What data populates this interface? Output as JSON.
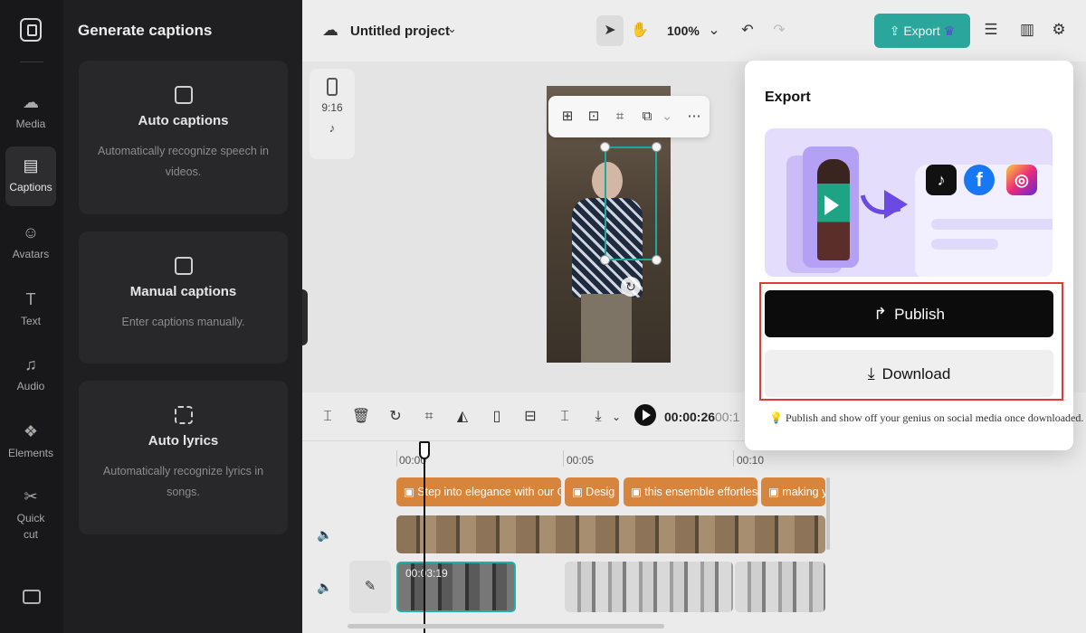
{
  "rail": {
    "items": [
      {
        "label": "Media",
        "icon": "cloud-upload-icon"
      },
      {
        "label": "Captions",
        "icon": "captions-icon"
      },
      {
        "label": "Avatars",
        "icon": "avatar-icon"
      },
      {
        "label": "Text",
        "icon": "text-icon"
      },
      {
        "label": "Audio",
        "icon": "music-note-icon"
      },
      {
        "label": "Elements",
        "icon": "elements-icon"
      },
      {
        "label": "Quick cut",
        "icon": "scissors-icon"
      }
    ],
    "active": "Captions"
  },
  "panel": {
    "title": "Generate captions",
    "cards": [
      {
        "title": "Auto captions",
        "desc": "Automatically recognize speech in videos.",
        "icon": "cc-icon"
      },
      {
        "title": "Manual captions",
        "desc": "Enter captions manually.",
        "icon": "subtitle-icon"
      },
      {
        "title": "Auto lyrics",
        "desc": "Automatically recognize lyrics in songs.",
        "icon": "lyrics-icon"
      }
    ]
  },
  "topbar": {
    "project_title": "Untitled project",
    "zoom": "100%",
    "export_label": "Export"
  },
  "canvas": {
    "aspect_ratio": "9:16"
  },
  "timeline": {
    "current_time": "00:00:26",
    "total_time_partial": "00:1",
    "ticks": [
      "00:00",
      "00:05",
      "00:10"
    ],
    "captions": [
      "Step into elegance with our G",
      "Desig",
      "this ensemble effortles",
      "making y"
    ],
    "selected_clip_time": "00:03:19"
  },
  "export_popup": {
    "title": "Export",
    "publish_label": "Publish",
    "download_label": "Download",
    "note": "Publish and show off your genius on social media once downloaded.",
    "social_icons": [
      "tiktok-icon",
      "facebook-icon",
      "instagram-icon"
    ]
  },
  "colors": {
    "accent": "#2aa69d",
    "caption_track": "#d7843d",
    "highlight": "#e53935",
    "promo_bg": "#e4ddfb"
  }
}
